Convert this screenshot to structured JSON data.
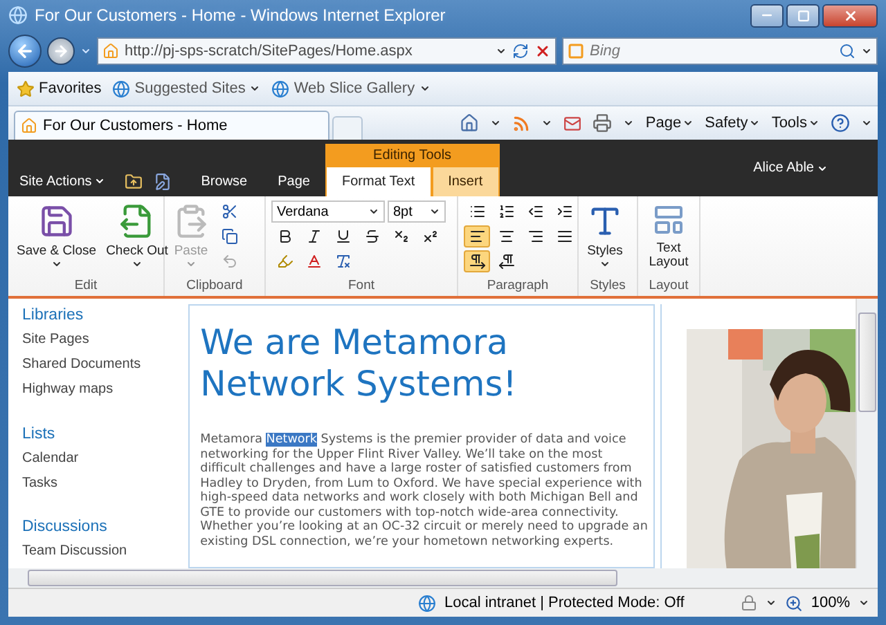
{
  "window": {
    "title": "For Our Customers - Home - Windows Internet Explorer"
  },
  "address_bar": {
    "url": "http://pj-sps-scratch/SitePages/Home.aspx"
  },
  "search": {
    "placeholder": "Bing"
  },
  "favorites_bar": {
    "items": [
      "Favorites",
      "Suggested Sites",
      "Web Slice Gallery"
    ]
  },
  "tabs": [
    {
      "label": "For Our Customers - Home"
    }
  ],
  "command_bar": {
    "menus": [
      "Page",
      "Safety",
      "Tools"
    ]
  },
  "ribbon": {
    "site_actions": "Site Actions",
    "context_group": "Editing Tools",
    "user": "Alice Able",
    "tabs": [
      {
        "label": "Browse",
        "selected": false,
        "contextual": false
      },
      {
        "label": "Page",
        "selected": false,
        "contextual": false
      },
      {
        "label": "Format Text",
        "selected": true,
        "contextual": true
      },
      {
        "label": "Insert",
        "selected": false,
        "contextual": true
      }
    ],
    "edit": {
      "label": "Edit",
      "buttons": [
        "Save & Close",
        "Check Out"
      ]
    },
    "clipboard": {
      "label": "Clipboard",
      "paste": {
        "label": "Paste",
        "disabled": true
      }
    },
    "font": {
      "label": "Font",
      "font_name": "Verdana",
      "font_size": "8pt"
    },
    "paragraph": {
      "label": "Paragraph",
      "alignment": [
        {
          "kind": "left",
          "selected": true
        },
        {
          "kind": "center",
          "selected": false
        },
        {
          "kind": "right",
          "selected": false
        },
        {
          "kind": "justify",
          "selected": false
        }
      ],
      "direction": [
        {
          "kind": "ltr",
          "selected": true
        },
        {
          "kind": "rtl",
          "selected": false
        }
      ]
    },
    "styles": {
      "label": "Styles",
      "button": "Styles"
    },
    "layout": {
      "label": "Layout",
      "button": "Text Layout"
    }
  },
  "sidebar": {
    "sections": [
      {
        "heading": "Libraries",
        "items": [
          "Site Pages",
          "Shared Documents",
          "Highway maps"
        ]
      },
      {
        "heading": "Lists",
        "items": [
          "Calendar",
          "Tasks"
        ]
      },
      {
        "heading": "Discussions",
        "items": [
          "Team Discussion"
        ]
      }
    ]
  },
  "content": {
    "heading": "We are Metamora Network Systems!",
    "paragraph": {
      "before": "Metamora ",
      "selection": "Network",
      "after": " Systems is the premier provider of data and voice networking for the Upper Flint River Valley. We’ll take on the most difficult challenges and have a large roster of satisfied customers from Hadley to Dryden, from Lum to Oxford. We have special experience with high-speed data networks and work closely with both Michigan Bell and GTE to provide our customers with top-notch wide-area connectivity. Whether you’re looking at an OC-32 circuit or merely need to upgrade an existing DSL connection, we’re your hometown networking experts."
    }
  },
  "status_bar": {
    "zone": "Local intranet | Protected Mode: Off",
    "zoom": "100%"
  }
}
